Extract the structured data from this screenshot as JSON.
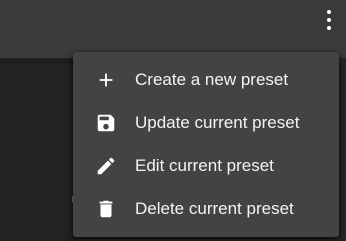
{
  "header": {
    "more_icon": "more-vert-icon"
  },
  "menu": {
    "items": [
      {
        "label": "Create a new preset",
        "icon": "plus-icon"
      },
      {
        "label": "Update current preset",
        "icon": "save-icon"
      },
      {
        "label": "Edit current preset",
        "icon": "pencil-icon"
      },
      {
        "label": "Delete current preset",
        "icon": "trash-icon"
      }
    ]
  },
  "colors": {
    "menu_bg": "#434343",
    "topbar_bg": "#3b3b3b",
    "text": "#f4f4f4"
  }
}
